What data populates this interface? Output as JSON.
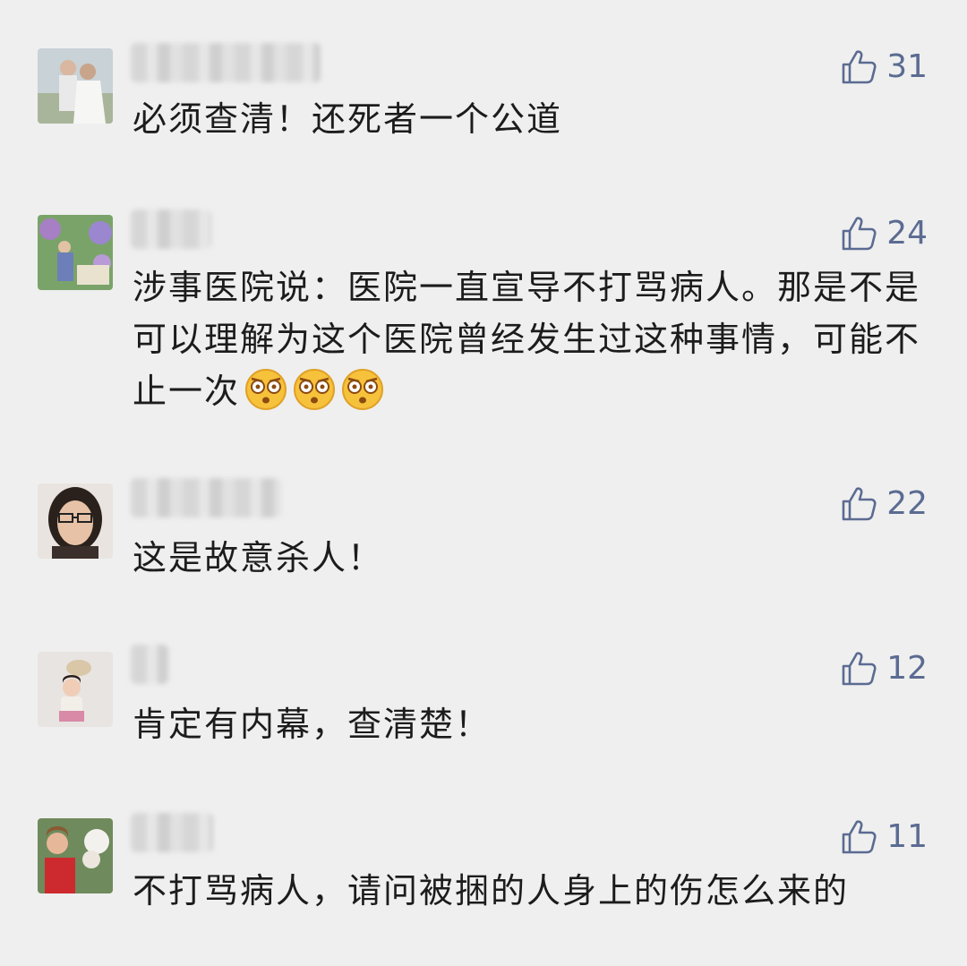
{
  "comments": [
    {
      "likes": "31",
      "text": "必须查清！还死者一个公道"
    },
    {
      "likes": "24",
      "text": "涉事医院说：医院一直宣导不打骂病人。那是不是可以理解为这个医院曾经发生过这种事情，可能不止一次",
      "emoji": [
        "shocked-face-icon",
        "shocked-face-icon",
        "shocked-face-icon"
      ]
    },
    {
      "likes": "22",
      "text": "这是故意杀人！"
    },
    {
      "likes": "12",
      "text": "肯定有内幕，查清楚！"
    },
    {
      "likes": "11",
      "text": "不打骂病人，请问被捆的人身上的伤怎么来的"
    }
  ],
  "colors": {
    "background": "#efefef",
    "like_accent": "#5b6b92",
    "text": "#1c1c1c"
  },
  "icons": {
    "like": "thumbs-up-icon"
  }
}
